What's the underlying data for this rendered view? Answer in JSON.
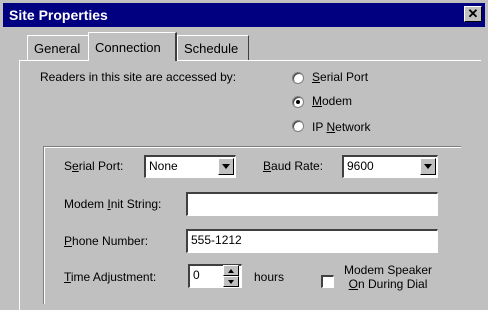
{
  "window": {
    "title": "Site Properties",
    "close_glyph": "✕",
    "close_icon": "close-icon"
  },
  "tabs": [
    {
      "label": "General",
      "active": false
    },
    {
      "label": "Connection",
      "active": true
    },
    {
      "label": "Schedule",
      "active": false
    }
  ],
  "access": {
    "prompt": "Readers in this site are accessed by:",
    "options": [
      {
        "pre": "",
        "mnemonic": "S",
        "post": "erial Port",
        "selected": false
      },
      {
        "pre": "",
        "mnemonic": "M",
        "post": "odem",
        "selected": true
      },
      {
        "pre": "IP ",
        "mnemonic": "N",
        "post": "etwork",
        "selected": false
      }
    ]
  },
  "settings": {
    "serial_port": {
      "label_pre": "S",
      "label_mnemonic": "e",
      "label_post": "rial Port:",
      "value": "None"
    },
    "baud_rate": {
      "label_pre": "",
      "label_mnemonic": "B",
      "label_post": "aud Rate:",
      "value": "9600"
    },
    "modem_init": {
      "label_pre": "Modem ",
      "label_mnemonic": "I",
      "label_post": "nit String:",
      "value": ""
    },
    "phone": {
      "label_pre": "",
      "label_mnemonic": "P",
      "label_post": "hone Number:",
      "value": "555-1212"
    },
    "time_adjust": {
      "label_pre": "",
      "label_mnemonic": "T",
      "label_post": "ime Adjustment:",
      "value": "0",
      "unit": "hours"
    },
    "speaker": {
      "line1": "Modem Speaker",
      "line2_mnemonic": "O",
      "line2_post": "n During Dial",
      "checked": false
    }
  }
}
